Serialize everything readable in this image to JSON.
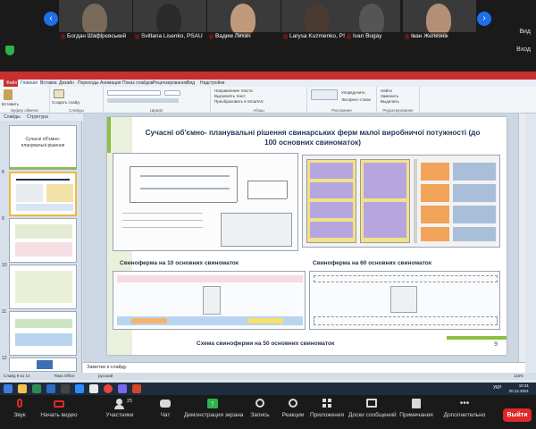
{
  "participants": [
    {
      "name": "Богдан Шафірєвський"
    },
    {
      "name": "Svitlana Lisenko, PSAU"
    },
    {
      "name": "Вадим Лихач"
    },
    {
      "name": "Larysa Kuzmenko, PS..."
    },
    {
      "name": "Ivan Bugay"
    },
    {
      "name": "Іван Железнік"
    }
  ],
  "zoom_top": {
    "view_label": "Вид",
    "exit_label": "Вход"
  },
  "ppt": {
    "menu": [
      "Файл",
      "Главная",
      "Вставка",
      "Дизайн",
      "Переходы",
      "Анимация",
      "Показ слайдов",
      "Рецензирование",
      "Вид",
      "Надстройки"
    ],
    "ribbon": {
      "paste": "Вставить",
      "create_slide": "Создать слайд",
      "group_clipboard": "Буфер обмена",
      "group_slides": "Слайды",
      "group_font": "Шрифт",
      "group_paragraph": "Абзац",
      "group_drawing": "Рисование",
      "group_editing": "Редактирование",
      "text_direction": "Направление текста",
      "align_text": "Выровнять текст",
      "convert_smartart": "Преобразовать в SmartArt",
      "arrange": "Упорядочить",
      "quick_styles": "Экспресс-стили",
      "find": "Найти",
      "replace": "Заменить",
      "select": "Выделить"
    },
    "pane_tabs": {
      "slides": "Слайды",
      "outline": "Структура"
    },
    "thumb1_text": "Сучасні об'ємно-планувальні рішення",
    "thumb_numbers": [
      "8",
      "9",
      "10",
      "11",
      "12",
      "13"
    ],
    "notes_placeholder": "Заметки к слайду",
    "status": {
      "slide": "Слайд 9 из 14",
      "theme": "Тема Office",
      "lang": "русский",
      "zoom": "115%"
    }
  },
  "slide": {
    "title": "Сучасні об'ємно- планувальні рішення свинарських ферм малої виробничої потужності (до 100 основних свиноматок)",
    "caption_left": "Свиноферма на 10 основних свиноматок",
    "caption_right": "Свиноферма на 60 основних свиноматок",
    "caption_bottom": "Схема свиноферми на 50 основних свиноматок",
    "number": "9"
  },
  "taskbar": {
    "time": "10:31",
    "date": "20.12.2021",
    "lang": "УКР"
  },
  "toolbar": {
    "audio": "Звук",
    "video": "Начать видео",
    "participants": "Участники",
    "participants_count": "25",
    "chat": "Чат",
    "share": "Демонстрация экрана",
    "record": "Запись",
    "reactions": "Реакции",
    "apps": "Приложения",
    "whiteboards": "Доски сообщений",
    "notes": "Примечания",
    "more": "Дополнительно",
    "leave": "Выйти"
  },
  "colors": {
    "zoom_bg": "#1a1a1a",
    "leave": "#e02828",
    "share_green": "#2fb24a",
    "slide_accent": "#8bbf3f",
    "ppt_red": "#c7302f"
  }
}
